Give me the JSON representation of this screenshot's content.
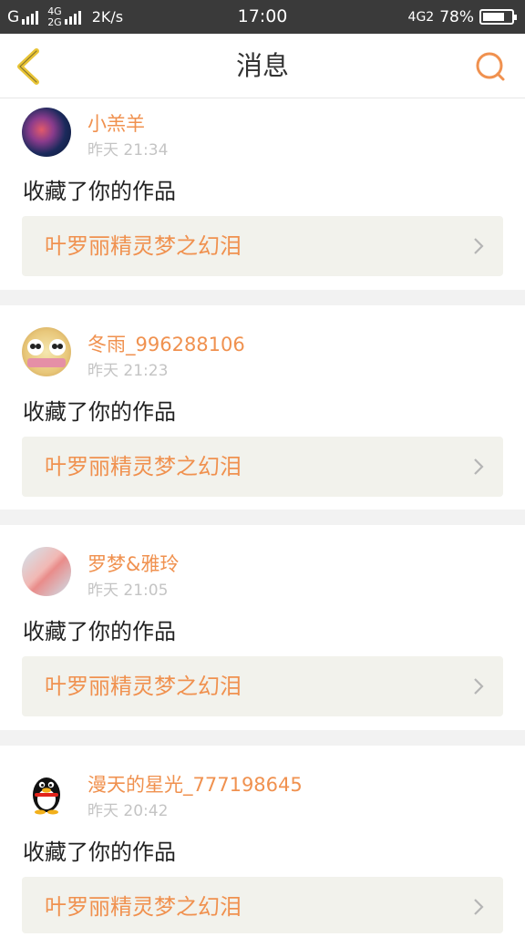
{
  "status_bar": {
    "carrier": "G",
    "network_top": "4G",
    "network_bottom": "2G",
    "speed": "2K/s",
    "time": "17:00",
    "network_right": "4G2",
    "battery": "78%",
    "battery_level": 0.78
  },
  "nav": {
    "title": "消息",
    "accent_color": "#f0914f",
    "back_icon_color": "#e8c436"
  },
  "messages": [
    {
      "user": "小羔羊",
      "time": "昨天 21:34",
      "action": "收藏了你的作品",
      "work": "叶罗丽精灵梦之幻泪",
      "avatar": "galaxy-avatar"
    },
    {
      "user": "冬雨_996288106",
      "time": "昨天 21:23",
      "action": "收藏了你的作品",
      "work": "叶罗丽精灵梦之幻泪",
      "avatar": "panda-avatar"
    },
    {
      "user": "罗梦&雅玲",
      "time": "昨天 21:05",
      "action": "收藏了你的作品",
      "work": "叶罗丽精灵梦之幻泪",
      "avatar": "anime-avatar"
    },
    {
      "user": "漫天的星光_777198645",
      "time": "昨天 20:42",
      "action": "收藏了你的作品",
      "work": "叶罗丽精灵梦之幻泪",
      "avatar": "qq-penguin-avatar"
    }
  ]
}
